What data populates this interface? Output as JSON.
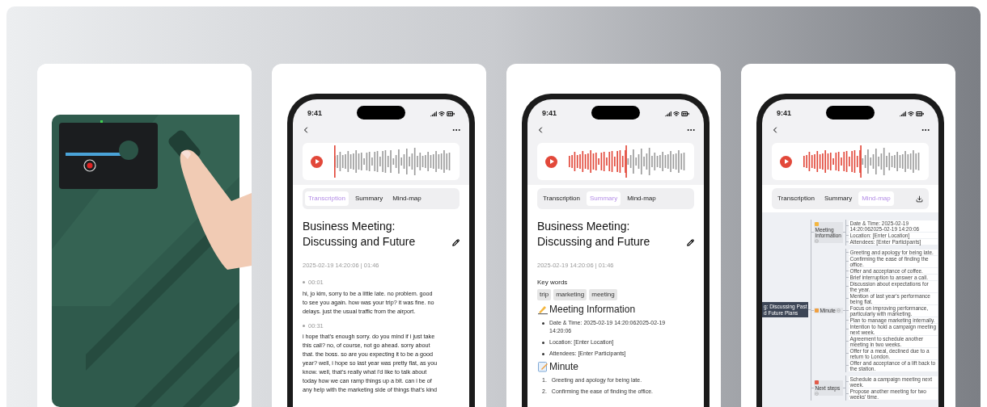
{
  "cards": [
    {
      "kind": "picture"
    },
    {
      "kind": "phone",
      "time": "9:41",
      "playback": {
        "level": 0
      },
      "download_button": false,
      "tabs": [
        {
          "label": "Transcription",
          "selected": true
        },
        {
          "label": "Summary",
          "selected": false
        },
        {
          "label": "Mind-map",
          "selected": false
        }
      ],
      "view": {
        "kind": "transcription",
        "title": "Business Meeting:\nDiscussing and Future",
        "meta": "2025-02-19 14:20:06 | 01:46",
        "segments": [
          {
            "time": "00:01",
            "text": "hi, jo kim, sorry to be a little late. no problem. good\nto see you again. how was your trip? it was fine. no\ndelays. just the usual traffic from the airport."
          },
          {
            "time": "00:31",
            "text": "i hope that’s enough sorry. do you mind if i just take\nthis call? no, of course, not go ahead. sorry about\nthat. the boss. so are you expecting it to be a good\nyear? well, i hope so last year was pretty flat, as you\nknow. well, that’s really what i’d like to talk about\ntoday how we can ramp things up a bit. can i be of\nany help with the marketing side of things that’s kind"
          }
        ]
      }
    },
    {
      "kind": "phone",
      "time": "9:41",
      "playback": {
        "level": 0.49
      },
      "download_button": false,
      "tabs": [
        {
          "label": "Transcription",
          "selected": false
        },
        {
          "label": "Summary",
          "selected": true
        },
        {
          "label": "Mind-map",
          "selected": false
        }
      ],
      "view": {
        "kind": "summary",
        "title": "Business Meeting:\nDiscussing and Future",
        "meta": "2025-02-19 14:20:06 | 01:46",
        "keywords_label": "Key words",
        "keywords": [
          "trip",
          "marketing",
          "meeting"
        ],
        "sections": [
          {
            "kind": "info",
            "heading": "Meeting Information",
            "items": [
              {
                "text": "Date & Time: 2025-02-19 14:20:062025-02-19 14:20:06"
              },
              {
                "text": "Location: [Enter Location]"
              },
              {
                "text": "Attendees: [Enter Participants]"
              }
            ]
          },
          {
            "kind": "minutes",
            "heading": "Minute",
            "items": [
              {
                "number": "1.",
                "text": "Greeting and apology for being late."
              },
              {
                "number": "2.",
                "text": "Confirming the ease of finding the office."
              }
            ]
          }
        ]
      }
    },
    {
      "kind": "phone",
      "time": "9:41",
      "playback": {
        "level": 0.49
      },
      "download_button": true,
      "tabs": [
        {
          "label": "Transcription",
          "selected": false
        },
        {
          "label": "Summary",
          "selected": false
        },
        {
          "label": "Mind-map",
          "selected": true
        }
      ],
      "view": {
        "kind": "mindmap",
        "root": "g: Discussing Past\nd Future Plans",
        "branches": [
          {
            "kind": "info",
            "label": "Meeting Information",
            "children": [
              "Date & Time: 2025-02-19 14:20:062025-02-19 14:20:06",
              "Location: [Enter Location]",
              "Attendees: [Enter Participants]"
            ]
          },
          {
            "kind": "minutes",
            "label": "Minute",
            "children": [
              "Greeting and apology for being late.",
              "Confirming the ease of finding the office.",
              "Offer and acceptance of coffee.",
              "Brief interruption to answer a call.",
              "Discussion about expectations for the year.",
              "Mention of last year's performance being flat.",
              "Focus on improving performance, particularly with marketing.",
              "Plan to manage marketing internally.",
              "Intention to hold a campaign meeting next week.",
              "Agreement to schedule another meeting in two weeks.",
              "Offer for a meal, declined due to a return to London.",
              "Offer and acceptance of a lift back to the station."
            ]
          },
          {
            "kind": "steps",
            "label": "Next steps",
            "children": [
              "Schedule a campaign meeting next week.",
              "Propose another meeting for two weeks' time."
            ]
          }
        ]
      }
    }
  ]
}
